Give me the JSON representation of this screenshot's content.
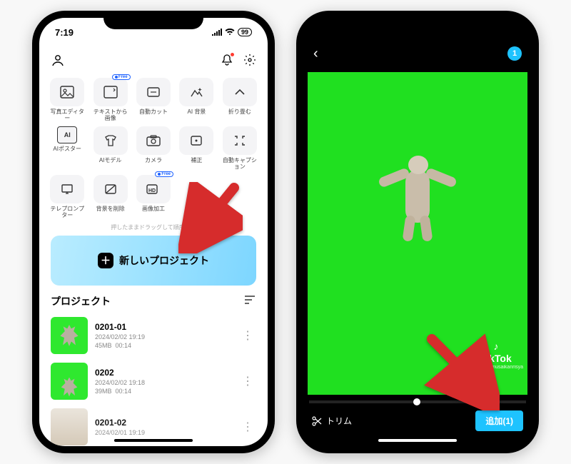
{
  "status": {
    "time": "7:19",
    "battery": "99"
  },
  "top": {
    "profile": "profile",
    "notif": "notif",
    "settings": "settings"
  },
  "tools": {
    "row1": [
      {
        "label": "写真エディター",
        "glyph": "⧉"
      },
      {
        "label": "テキストから画像",
        "glyph": "⧉",
        "free": "Free"
      },
      {
        "label": "自動カット",
        "glyph": "⧉"
      },
      {
        "label": "AI 背景",
        "glyph": "✦"
      },
      {
        "label": "折り畳む",
        "glyph": "˄"
      }
    ],
    "row2": [
      {
        "label": "AIポスター",
        "glyph": "AI"
      },
      {
        "label": "AIモデル",
        "glyph": "👕"
      },
      {
        "label": "カメラ",
        "glyph": "◉"
      },
      {
        "label": "補正",
        "glyph": "▭"
      },
      {
        "label": "自動キャプション",
        "glyph": "⟨⟩"
      }
    ],
    "row3": [
      {
        "label": "テレプロンプター",
        "glyph": "▭"
      },
      {
        "label": "背景を削除",
        "glyph": "◪"
      },
      {
        "label": "画像加工",
        "glyph": "HD",
        "free": "Free"
      }
    ]
  },
  "hint": "押したままドラッグして順序を…",
  "new_project": "新しいプロジェクト",
  "projects_header": "プロジェクト",
  "projects": [
    {
      "name": "0201-01",
      "date": "2024/02/02 19:19",
      "size": "45MB",
      "dur": "00:14"
    },
    {
      "name": "0202",
      "date": "2024/02/02 19:18",
      "size": "39MB",
      "dur": "00:14"
    },
    {
      "name": "0201-02",
      "date": "2024/02/01 19:19",
      "size": "",
      "dur": ""
    }
  ],
  "right": {
    "count": "1",
    "tiktok": "TikTok",
    "tt_user": "@ nekomimusaikanrisya",
    "trim": "トリム",
    "add": "追加(1)"
  }
}
